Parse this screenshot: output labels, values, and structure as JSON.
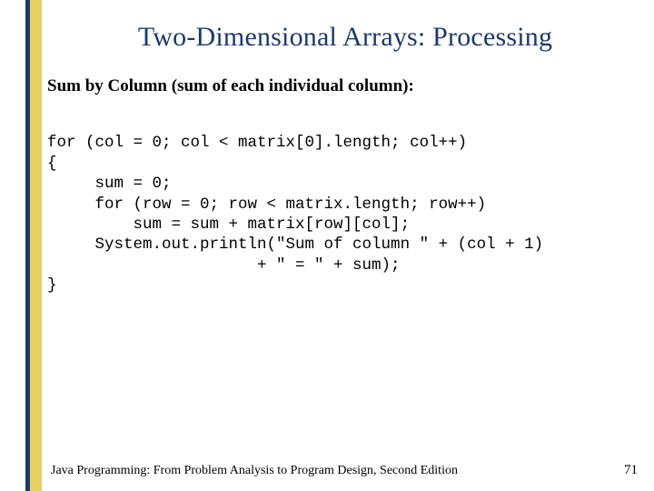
{
  "title": "Two-Dimensional Arrays: Processing",
  "subhead": "Sum by Column (sum of each individual column):",
  "code": {
    "l1": "for (col = 0; col < matrix[0].length; col++)",
    "l2": "{",
    "l3": "     sum = 0;",
    "l4": "     for (row = 0; row < matrix.length; row++)",
    "l5": "         sum = sum + matrix[row][col];",
    "l6": "     System.out.println(\"Sum of column \" + (col + 1)",
    "l7": "                      + \" = \" + sum);",
    "l8": "}"
  },
  "footer": {
    "text": "Java Programming: From Problem Analysis to Program Design, Second Edition",
    "page": "71"
  }
}
